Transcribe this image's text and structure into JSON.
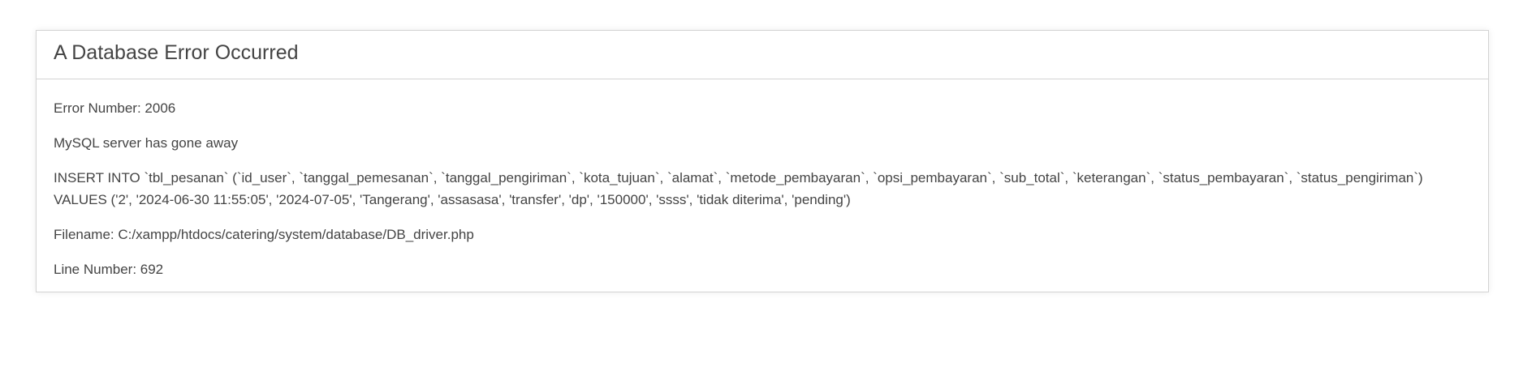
{
  "error": {
    "heading": "A Database Error Occurred",
    "error_number": "Error Number: 2006",
    "message": "MySQL server has gone away",
    "query_line1": "INSERT INTO `tbl_pesanan` (`id_user`, `tanggal_pemesanan`, `tanggal_pengiriman`, `kota_tujuan`, `alamat`, `metode_pembayaran`, `opsi_pembayaran`, `sub_total`, `keterangan`, `status_pembayaran`, `status_pengiriman`)",
    "query_line2": "VALUES ('2', '2024-06-30 11:55:05', '2024-07-05', 'Tangerang', 'assasasa', 'transfer', 'dp', '150000', 'ssss', 'tidak diterima', 'pending')",
    "filename": "Filename: C:/xampp/htdocs/catering/system/database/DB_driver.php",
    "line_number": "Line Number: 692"
  }
}
